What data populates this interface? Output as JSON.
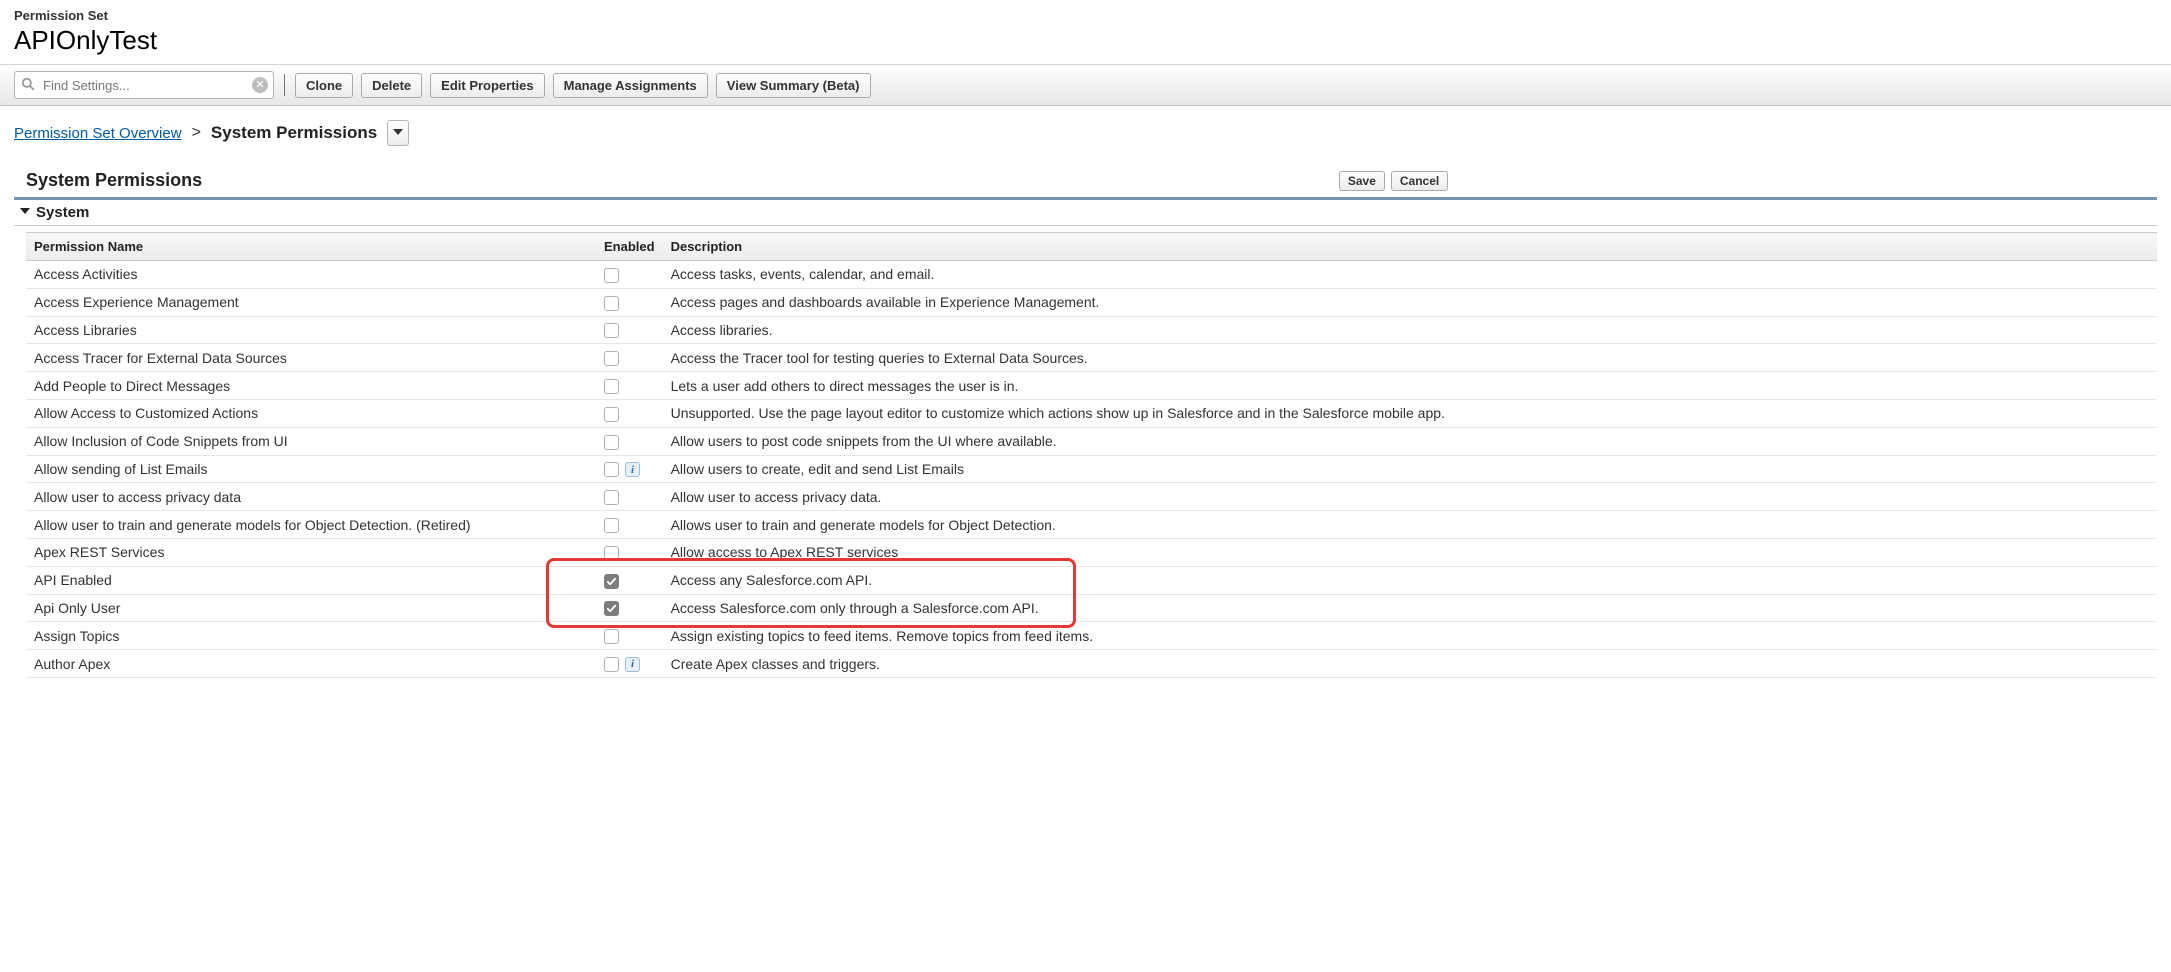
{
  "header": {
    "subtitle": "Permission Set",
    "title": "APIOnlyTest"
  },
  "toolbar": {
    "search_placeholder": "Find Settings...",
    "buttons": {
      "clone": "Clone",
      "delete": "Delete",
      "edit_properties": "Edit Properties",
      "manage_assignments": "Manage Assignments",
      "view_summary": "View Summary (Beta)"
    }
  },
  "breadcrumb": {
    "overview": "Permission Set Overview",
    "sep": ">",
    "current": "System Permissions"
  },
  "section": {
    "heading": "System Permissions",
    "save": "Save",
    "cancel": "Cancel",
    "group": "System"
  },
  "table": {
    "col_name": "Permission Name",
    "col_enabled": "Enabled",
    "col_desc": "Description",
    "rows": [
      {
        "name": "Access Activities",
        "enabled": false,
        "info": false,
        "desc": "Access tasks, events, calendar, and email."
      },
      {
        "name": "Access Experience Management",
        "enabled": false,
        "info": false,
        "desc": "Access pages and dashboards available in Experience Management."
      },
      {
        "name": "Access Libraries",
        "enabled": false,
        "info": false,
        "desc": "Access libraries."
      },
      {
        "name": "Access Tracer for External Data Sources",
        "enabled": false,
        "info": false,
        "desc": "Access the Tracer tool for testing queries to External Data Sources."
      },
      {
        "name": "Add People to Direct Messages",
        "enabled": false,
        "info": false,
        "desc": "Lets a user add others to direct messages the user is in."
      },
      {
        "name": "Allow Access to Customized Actions",
        "enabled": false,
        "info": false,
        "desc": "Unsupported. Use the page layout editor to customize which actions show up in Salesforce and in the Salesforce mobile app."
      },
      {
        "name": "Allow Inclusion of Code Snippets from UI",
        "enabled": false,
        "info": false,
        "desc": "Allow users to post code snippets from the UI where available."
      },
      {
        "name": "Allow sending of List Emails",
        "enabled": false,
        "info": true,
        "desc": "Allow users to create, edit and send List Emails"
      },
      {
        "name": "Allow user to access privacy data",
        "enabled": false,
        "info": false,
        "desc": "Allow user to access privacy data."
      },
      {
        "name": "Allow user to train and generate models for Object Detection. (Retired)",
        "enabled": false,
        "info": false,
        "desc": "Allows user to train and generate models for Object Detection."
      },
      {
        "name": "Apex REST Services",
        "enabled": false,
        "info": false,
        "desc": "Allow access to Apex REST services"
      },
      {
        "name": "API Enabled",
        "enabled": true,
        "info": false,
        "desc": "Access any Salesforce.com API."
      },
      {
        "name": "Api Only User",
        "enabled": true,
        "info": false,
        "desc": "Access Salesforce.com only through a Salesforce.com API."
      },
      {
        "name": "Assign Topics",
        "enabled": false,
        "info": false,
        "desc": "Assign existing topics to feed items. Remove topics from feed items."
      },
      {
        "name": "Author Apex",
        "enabled": false,
        "info": true,
        "desc": "Create Apex classes and triggers."
      }
    ]
  }
}
